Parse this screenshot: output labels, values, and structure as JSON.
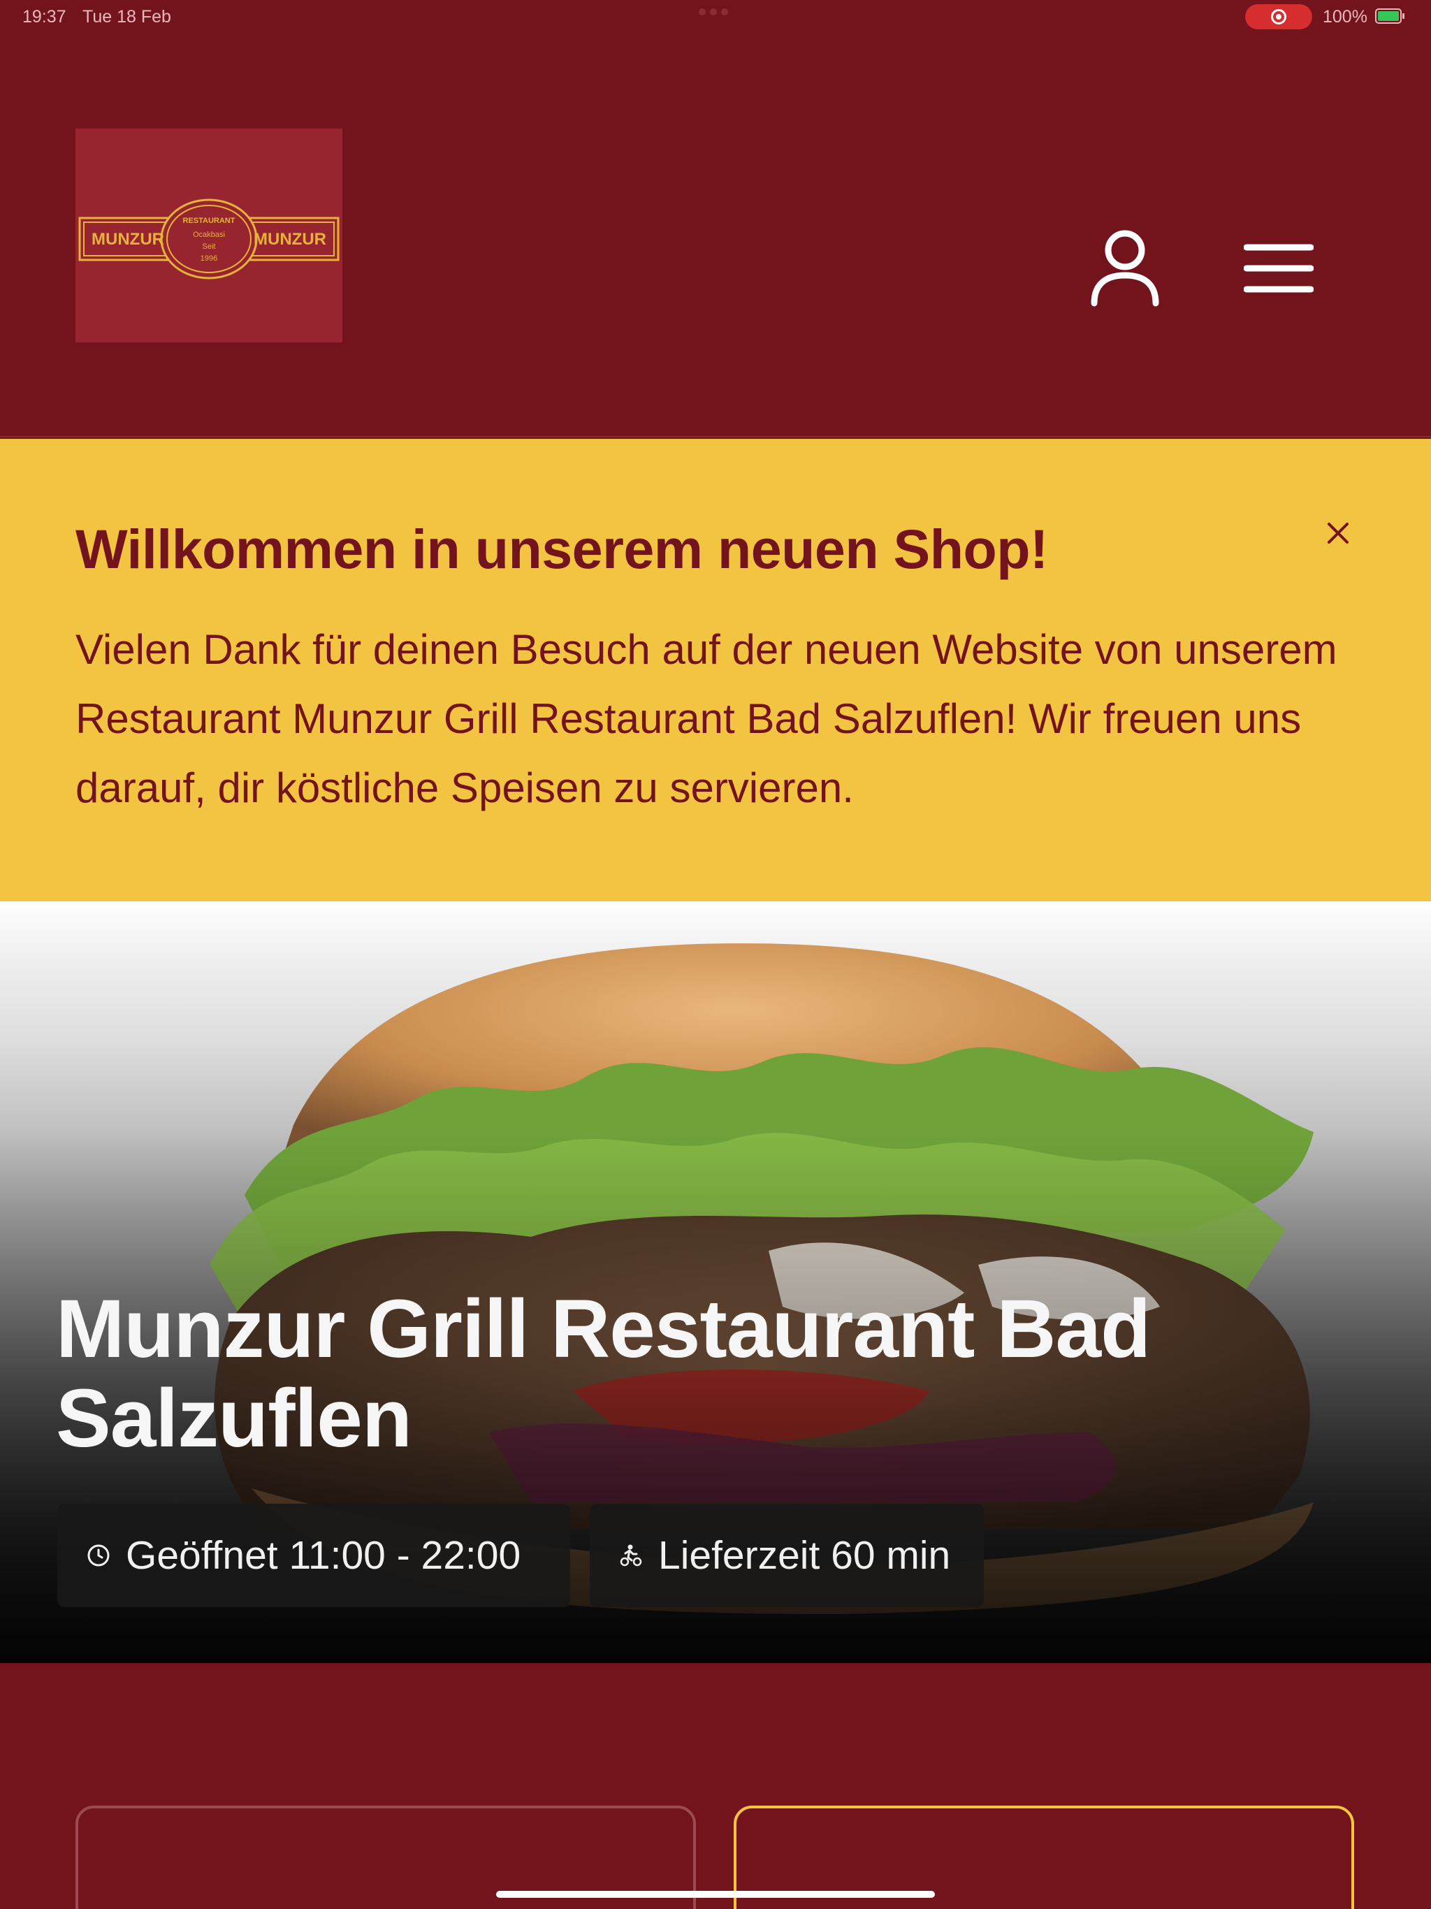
{
  "status_bar": {
    "time": "19:37",
    "date": "Tue 18 Feb",
    "battery": "100%"
  },
  "header": {
    "logo": {
      "alt": "Munzur Restaurant logo",
      "left_text": "MUNZUR",
      "right_text": "MUNZUR",
      "arc_text": "RESTAURANT",
      "center_lines": [
        "Ocakbasi",
        "Seit",
        "1996"
      ]
    },
    "account_icon": "user-icon",
    "menu_icon": "hamburger-menu-icon"
  },
  "banner": {
    "title": "Willkommen in unserem neuen Shop!",
    "text": "Vielen Dank für deinen Besuch auf der neuen Website von unserem Restaurant Munzur Grill Restaurant Bad Salzuflen! Wir freuen uns darauf, dir köstliche Speisen zu servieren.",
    "close_icon": "close-icon"
  },
  "hero": {
    "title": "Munzur Grill Restaurant Bad Salzuflen",
    "opening_hours": "Geöffnet 11:00 - 22:00",
    "delivery_time": "Lieferzeit 60 min",
    "image": "döner kebab sandwich photo"
  },
  "colors": {
    "brand_red": "#73141c",
    "brand_yellow": "#f3c342",
    "logo_bg": "#97252f"
  }
}
